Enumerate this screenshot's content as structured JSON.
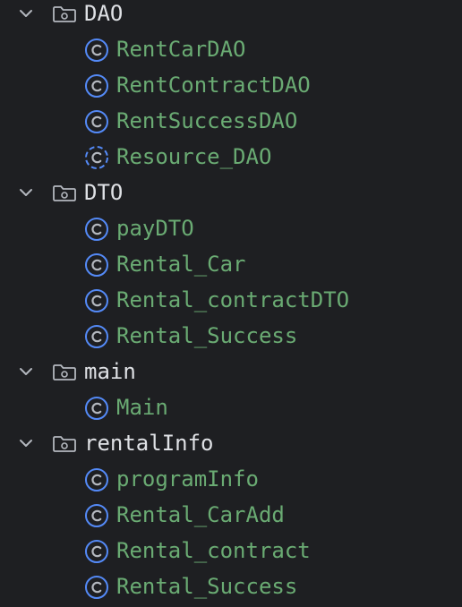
{
  "project_tree": {
    "nodes": [
      {
        "kind": "folder",
        "label": "DAO",
        "icon": "folder-icon",
        "expanded": true
      },
      {
        "kind": "class",
        "label": "RentCarDAO",
        "icon": "class-icon"
      },
      {
        "kind": "class",
        "label": "RentContractDAO",
        "icon": "class-icon"
      },
      {
        "kind": "class",
        "label": "RentSuccessDAO",
        "icon": "class-icon"
      },
      {
        "kind": "class",
        "label": "Resource_DAO",
        "icon": "abstract-class-icon"
      },
      {
        "kind": "folder",
        "label": "DTO",
        "icon": "folder-icon",
        "expanded": true
      },
      {
        "kind": "class",
        "label": "payDTO",
        "icon": "class-icon"
      },
      {
        "kind": "class",
        "label": "Rental_Car",
        "icon": "class-icon"
      },
      {
        "kind": "class",
        "label": "Rental_contractDTO",
        "icon": "class-icon"
      },
      {
        "kind": "class",
        "label": "Rental_Success",
        "icon": "class-icon"
      },
      {
        "kind": "folder",
        "label": "main",
        "icon": "folder-icon",
        "expanded": true
      },
      {
        "kind": "class",
        "label": "Main",
        "icon": "class-icon"
      },
      {
        "kind": "folder",
        "label": "rentalInfo",
        "icon": "folder-icon",
        "expanded": true
      },
      {
        "kind": "class",
        "label": "programInfo",
        "icon": "class-icon"
      },
      {
        "kind": "class",
        "label": "Rental_CarAdd",
        "icon": "class-icon"
      },
      {
        "kind": "class",
        "label": "Rental_contract",
        "icon": "class-icon"
      },
      {
        "kind": "class",
        "label": "Rental_Success",
        "icon": "class-icon"
      }
    ]
  },
  "colors": {
    "background": "#1e1f22",
    "folder_text": "#dfe1e5",
    "class_text": "#6aab73",
    "class_icon_ring": "#548af7",
    "icon_gray": "#b4b8bf"
  }
}
